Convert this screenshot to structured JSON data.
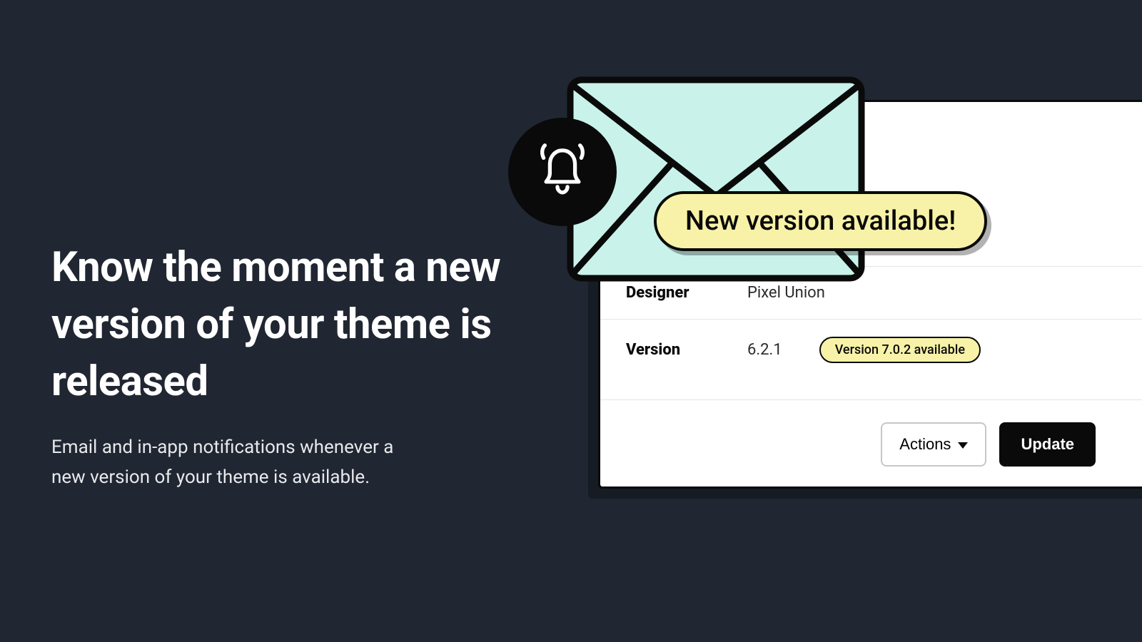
{
  "hero": {
    "headline": "Know the moment a new version of your theme is released",
    "subtext": "Email and in-app notifications whenever a new version of your theme is available."
  },
  "banner": {
    "label": "New version available!"
  },
  "card": {
    "designer_label": "Designer",
    "designer_value": "Pixel Union",
    "version_label": "Version",
    "version_value": "6.2.1",
    "version_badge": "Version 7.0.2 available",
    "actions_label": "Actions",
    "update_label": "Update"
  }
}
